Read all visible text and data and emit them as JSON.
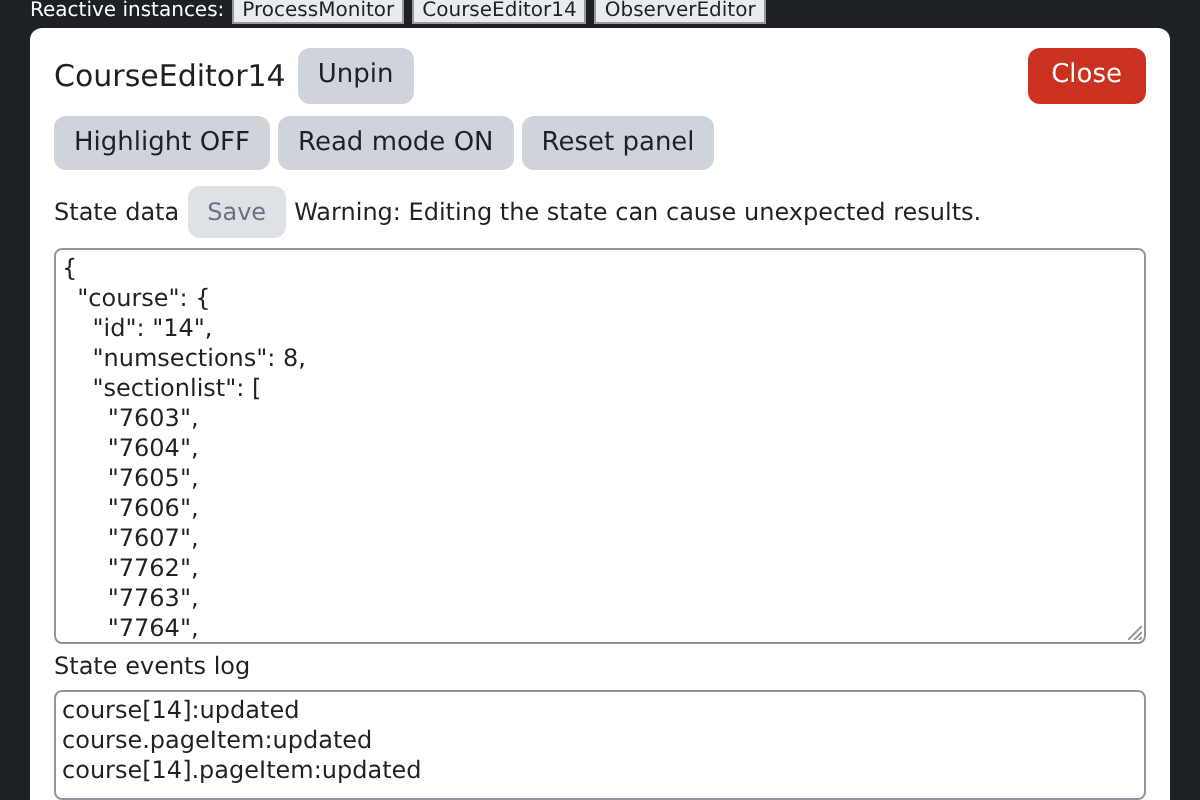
{
  "instances_bar": {
    "label": "Reactive instances:",
    "tabs": [
      "ProcessMonitor",
      "CourseEditor14",
      "ObserverEditor"
    ]
  },
  "panel": {
    "title": "CourseEditor14",
    "pin_button": "Unpin",
    "close_button": "Close",
    "actions": [
      "Highlight OFF",
      "Read mode ON",
      "Reset panel"
    ],
    "state_label": "State data",
    "save_button": {
      "label": "Save",
      "disabled": true
    },
    "warning": "Warning: Editing the state can cause unexpected results.",
    "state_lines": [
      "{",
      "  \"course\": {",
      "    \"id\": \"14\",",
      "    \"numsections\": 8,",
      "    \"sectionlist\": [",
      "      \"7603\",",
      "      \"7604\",",
      "      \"7605\",",
      "      \"7606\",",
      "      \"7607\",",
      "      \"7762\",",
      "      \"7763\",",
      "      \"7764\","
    ],
    "log_label": "State events log",
    "log_lines": [
      "course[14]:updated",
      "course.pageItem:updated",
      "course[14].pageItem:updated"
    ]
  }
}
